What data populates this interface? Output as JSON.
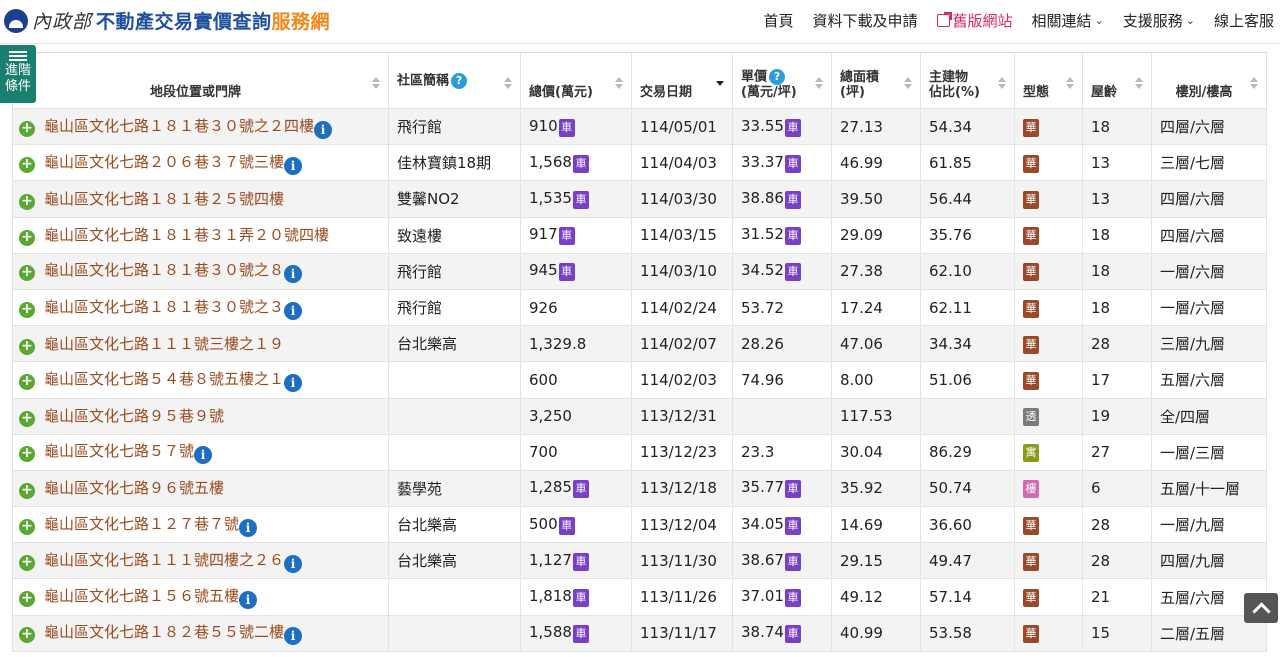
{
  "header": {
    "ministry": "內政部",
    "site_name": "不動產交易實價查詢",
    "site_suffix": "服務網",
    "nav": [
      {
        "label": "首頁",
        "dropdown": false
      },
      {
        "label": "資料下載及申請",
        "dropdown": false
      },
      {
        "label": "舊版網站",
        "dropdown": false,
        "external": true
      },
      {
        "label": "相關連結",
        "dropdown": true
      },
      {
        "label": "支援服務",
        "dropdown": true
      },
      {
        "label": "線上客服",
        "dropdown": false
      }
    ]
  },
  "advanced_filter": {
    "line1": "進階",
    "line2": "條件"
  },
  "table": {
    "columns": {
      "address": "地段位置或門牌",
      "community": "社區簡稱",
      "total_price": "總價(萬元)",
      "date": "交易日期",
      "unit_price": "單價",
      "unit_price_unit": "(萬元/坪)",
      "area": "總面積",
      "area_unit": "(坪)",
      "main_ratio": "主建物",
      "main_ratio_2": "佔比(%)",
      "type": "型態",
      "age": "屋齡",
      "floor": "樓別/樓高"
    },
    "help_glyph": "?",
    "car_glyph": "車",
    "info_glyph": "i",
    "plus_glyph": "+",
    "type_colors": {
      "華": "#9a4a2a",
      "透": "#7a7a7a",
      "寓": "#8a9a1a",
      "樓": "#d26ab0"
    },
    "rows": [
      {
        "address": "龜山區文化七路１８１巷３０號之２四樓",
        "info": true,
        "community": "飛行館",
        "total_price": "910",
        "total_car": true,
        "date": "114/05/01",
        "unit_price": "33.55",
        "unit_car": true,
        "area": "27.13",
        "main_ratio": "54.34",
        "type": "華",
        "age": "18",
        "floor": "四層/六層"
      },
      {
        "address": "龜山區文化七路２０６巷３７號三樓",
        "info": true,
        "community": "佳林寶鎮18期",
        "total_price": "1,568",
        "total_car": true,
        "date": "114/04/03",
        "unit_price": "33.37",
        "unit_car": true,
        "area": "46.99",
        "main_ratio": "61.85",
        "type": "華",
        "age": "13",
        "floor": "三層/七層"
      },
      {
        "address": "龜山區文化七路１８１巷２５號四樓",
        "info": false,
        "community": "雙馨NO2",
        "total_price": "1,535",
        "total_car": true,
        "date": "114/03/30",
        "unit_price": "38.86",
        "unit_car": true,
        "area": "39.50",
        "main_ratio": "56.44",
        "type": "華",
        "age": "13",
        "floor": "四層/六層"
      },
      {
        "address": "龜山區文化七路１８１巷３１弄２０號四樓",
        "info": false,
        "community": "致遠樓",
        "total_price": "917",
        "total_car": true,
        "date": "114/03/15",
        "unit_price": "31.52",
        "unit_car": true,
        "area": "29.09",
        "main_ratio": "35.76",
        "type": "華",
        "age": "18",
        "floor": "四層/六層"
      },
      {
        "address": "龜山區文化七路１８１巷３０號之８",
        "info": true,
        "community": "飛行館",
        "total_price": "945",
        "total_car": true,
        "date": "114/03/10",
        "unit_price": "34.52",
        "unit_car": true,
        "area": "27.38",
        "main_ratio": "62.10",
        "type": "華",
        "age": "18",
        "floor": "一層/六層"
      },
      {
        "address": "龜山區文化七路１８１巷３０號之３",
        "info": true,
        "community": "飛行館",
        "total_price": "926",
        "total_car": false,
        "date": "114/02/24",
        "unit_price": "53.72",
        "unit_car": false,
        "area": "17.24",
        "main_ratio": "62.11",
        "type": "華",
        "age": "18",
        "floor": "一層/六層"
      },
      {
        "address": "龜山區文化七路１１１號三樓之１９",
        "info": false,
        "community": "台北樂高",
        "total_price": "1,329.8",
        "total_car": false,
        "date": "114/02/07",
        "unit_price": "28.26",
        "unit_car": false,
        "area": "47.06",
        "main_ratio": "34.34",
        "type": "華",
        "age": "28",
        "floor": "三層/九層"
      },
      {
        "address": "龜山區文化七路５４巷８號五樓之１",
        "info": true,
        "community": "",
        "total_price": "600",
        "total_car": false,
        "date": "114/02/03",
        "unit_price": "74.96",
        "unit_car": false,
        "area": "8.00",
        "main_ratio": "51.06",
        "type": "華",
        "age": "17",
        "floor": "五層/六層"
      },
      {
        "address": "龜山區文化七路９５巷９號",
        "info": false,
        "community": "",
        "total_price": "3,250",
        "total_car": false,
        "date": "113/12/31",
        "unit_price": "",
        "unit_car": false,
        "area": "117.53",
        "main_ratio": "",
        "type": "透",
        "age": "19",
        "floor": "全/四層"
      },
      {
        "address": "龜山區文化七路５７號",
        "info": true,
        "community": "",
        "total_price": "700",
        "total_car": false,
        "date": "113/12/23",
        "unit_price": "23.3",
        "unit_car": false,
        "area": "30.04",
        "main_ratio": "86.29",
        "type": "寓",
        "age": "27",
        "floor": "一層/三層"
      },
      {
        "address": "龜山區文化七路９６號五樓",
        "info": false,
        "community": "藝學苑",
        "total_price": "1,285",
        "total_car": true,
        "date": "113/12/18",
        "unit_price": "35.77",
        "unit_car": true,
        "area": "35.92",
        "main_ratio": "50.74",
        "type": "樓",
        "age": "6",
        "floor": "五層/十一層"
      },
      {
        "address": "龜山區文化七路１２７巷７號",
        "info": true,
        "community": "台北樂高",
        "total_price": "500",
        "total_car": true,
        "date": "113/12/04",
        "unit_price": "34.05",
        "unit_car": true,
        "area": "14.69",
        "main_ratio": "36.60",
        "type": "華",
        "age": "28",
        "floor": "一層/九層"
      },
      {
        "address": "龜山區文化七路１１１號四樓之２６",
        "info": true,
        "community": "台北樂高",
        "total_price": "1,127",
        "total_car": true,
        "date": "113/11/30",
        "unit_price": "38.67",
        "unit_car": true,
        "area": "29.15",
        "main_ratio": "49.47",
        "type": "華",
        "age": "28",
        "floor": "四層/九層"
      },
      {
        "address": "龜山區文化七路１５６號五樓",
        "info": true,
        "community": "",
        "total_price": "1,818",
        "total_car": true,
        "date": "113/11/26",
        "unit_price": "37.01",
        "unit_car": true,
        "area": "49.12",
        "main_ratio": "57.14",
        "type": "華",
        "age": "21",
        "floor": "五層/六層"
      },
      {
        "address": "龜山區文化七路１８２巷５５號二樓",
        "info": true,
        "community": "",
        "total_price": "1,588",
        "total_car": true,
        "date": "113/11/17",
        "unit_price": "38.74",
        "unit_car": true,
        "area": "40.99",
        "main_ratio": "53.58",
        "type": "華",
        "age": "15",
        "floor": "二層/五層"
      }
    ]
  }
}
